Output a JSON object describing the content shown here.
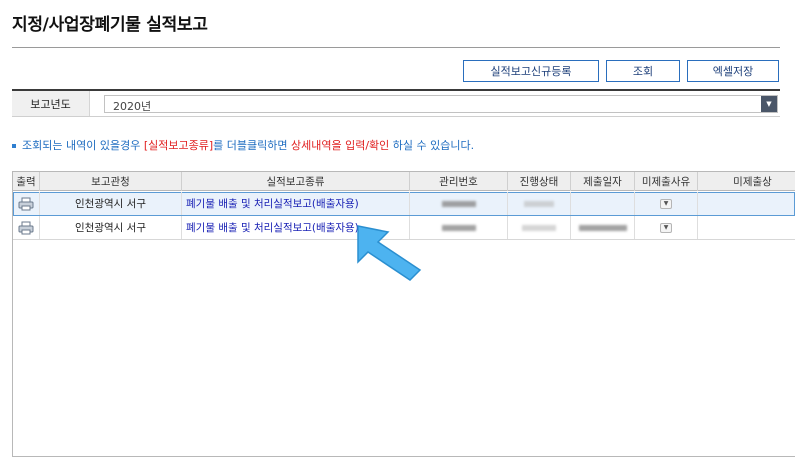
{
  "page": {
    "title": "지정/사업장폐기물 실적보고"
  },
  "toolbar": {
    "register_label": "실적보고신규등록",
    "search_label": "조회",
    "excel_label": "엑셀저장"
  },
  "filter": {
    "year_label": "보고년도",
    "year_value": "2020년"
  },
  "notice": {
    "part1": "조회되는 내역이 있을경우 ",
    "highlight1": "[실적보고종류]",
    "part2": "를 더블클릭",
    "part3": "하면 ",
    "highlight2": "상세내역을 입력/확인",
    "part4": " 하실 수 있습니다."
  },
  "grid": {
    "columns": [
      "출력",
      "보고관청",
      "실적보고종류",
      "관리번호",
      "진행상태",
      "제출일자",
      "미제출사유",
      "미제출상"
    ],
    "rows": [
      {
        "print_icon": "printer-icon",
        "office": "인천광역시 서구",
        "report_type": "폐기물 배출 및 처리실적보고(배출자용)"
      },
      {
        "print_icon": "printer-icon",
        "office": "인천광역시 서구",
        "report_type": "폐기물 배출 및 처리실적보고(배출자용)"
      }
    ]
  },
  "colors": {
    "accent": "#2a6ebd",
    "link": "#1a22b5",
    "notice_blue": "#1e6cc0",
    "notice_red": "#e02020",
    "pointer": "#4db3f0"
  }
}
